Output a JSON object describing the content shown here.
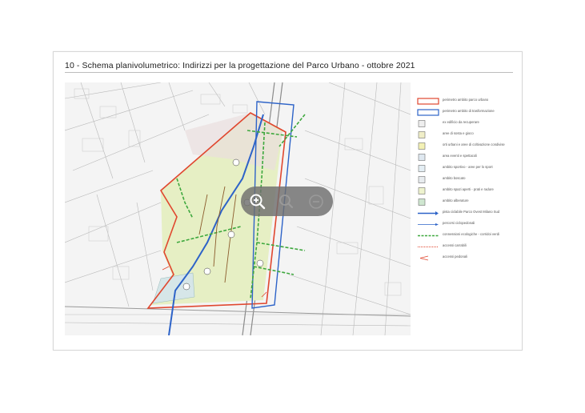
{
  "slide": {
    "title": "10 - Schema planivolumetrico: Indirizzi per la progettazione del Parco Urbano - ottobre 2021"
  },
  "legend": {
    "items": [
      {
        "symbol": "red-outline",
        "label": "perimetro ambito parco urbano"
      },
      {
        "symbol": "blue-outline",
        "label": "perimetro ambito di trasformazione"
      },
      {
        "symbol": "icon-box",
        "label": "ex edificio da recuperare"
      },
      {
        "symbol": "icon-box",
        "label": "aree di sosta e gioco"
      },
      {
        "symbol": "icon-box",
        "label": "orti urbani e aree di coltivazione condivise"
      },
      {
        "symbol": "icon-box",
        "label": "area eventi e spettacoli"
      },
      {
        "symbol": "icon-box",
        "label": "ambito sportivo - aree per lo sport"
      },
      {
        "symbol": "icon-box",
        "label": "ambito boscato"
      },
      {
        "symbol": "icon-box",
        "label": "ambito spazi aperti - prati e radure"
      },
      {
        "symbol": "icon-box",
        "label": "ambito alberature"
      },
      {
        "symbol": "blue-line-arrow",
        "label": "pista ciclabile Parco Ovest Milano Sud"
      },
      {
        "symbol": "blue-thin-arrow",
        "label": "percorsi ciclopedonali"
      },
      {
        "symbol": "green-dashed",
        "label": "connessioni ecologiche - corridoi verdi"
      },
      {
        "symbol": "red-dotted",
        "label": "accessi carrabili"
      },
      {
        "symbol": "red-arrow",
        "label": "accessi pedonali"
      }
    ]
  },
  "viewer_toolbar": {
    "buttons": [
      {
        "name": "zoom-in",
        "icon": "zoom-in-icon"
      },
      {
        "name": "zoom-reset",
        "icon": "magnifier-icon"
      },
      {
        "name": "zoom-out",
        "icon": "zoom-out-icon"
      }
    ]
  },
  "colors": {
    "park_perimeter": "#e0472f",
    "transformation_perimeter": "#2d63c8",
    "green_corridor": "#3ea83e",
    "area_fill": "#e6efc4",
    "toolbar_bg": "#6e6e6e"
  }
}
